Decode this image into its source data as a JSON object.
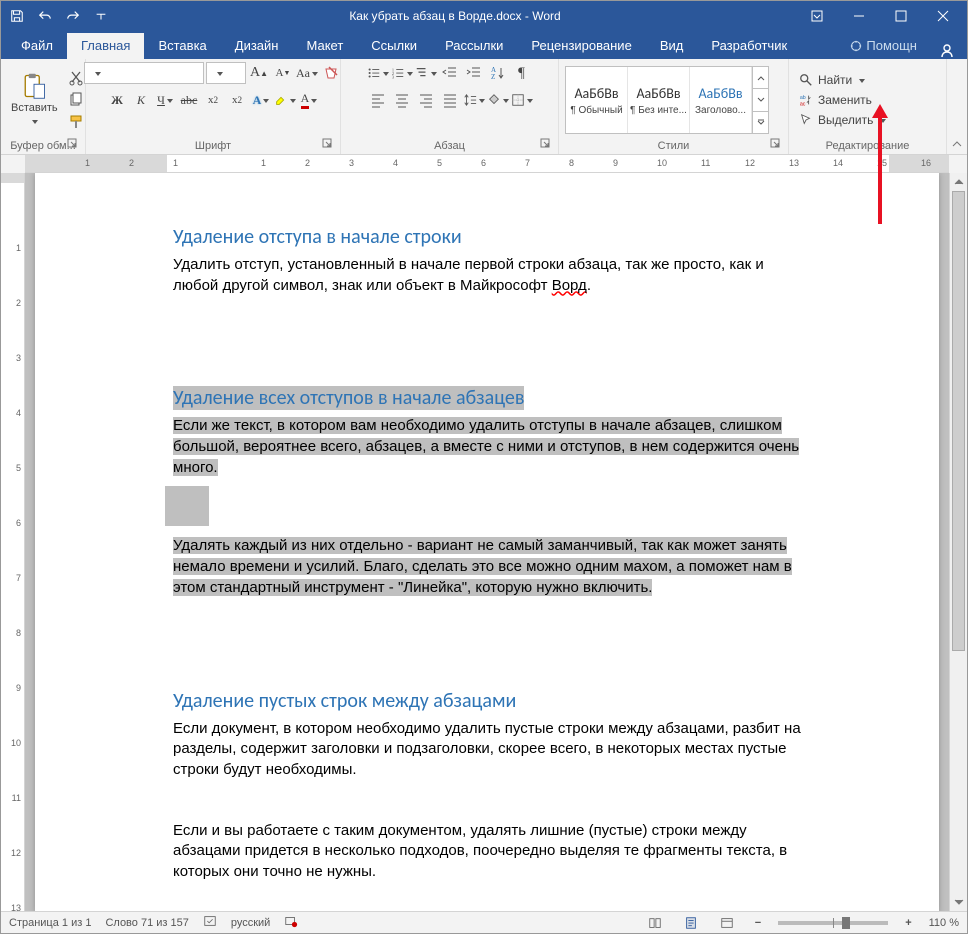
{
  "title_bar": {
    "doc_title": "Как убрать абзац в Ворде.docx - Word"
  },
  "tabs": {
    "file": "Файл",
    "home": "Главная",
    "insert": "Вставка",
    "design": "Дизайн",
    "layout": "Макет",
    "references": "Ссылки",
    "mailings": "Рассылки",
    "review": "Рецензирование",
    "view": "Вид",
    "developer": "Разработчик",
    "help": "Помощн"
  },
  "ribbon": {
    "clipboard": {
      "paste": "Вставить",
      "label": "Буфер обм..."
    },
    "font": {
      "name": "",
      "size": "",
      "label": "Шрифт"
    },
    "paragraph": {
      "label": "Абзац"
    },
    "styles": {
      "label": "Стили",
      "preview": "АаБбВв",
      "items": [
        {
          "name": "¶ Обычный"
        },
        {
          "name": "¶ Без инте..."
        },
        {
          "name": "Заголово..."
        }
      ]
    },
    "editing": {
      "label": "Редактирование",
      "find": "Найти",
      "replace": "Заменить",
      "select": "Выделить"
    }
  },
  "ruler": {
    "h_ticks": [
      "1",
      "2",
      "1",
      "",
      "1",
      "2",
      "3",
      "4",
      "5",
      "6",
      "7",
      "8",
      "9",
      "10",
      "11",
      "12",
      "13",
      "14",
      "15",
      "16"
    ],
    "v_ticks": [
      "",
      "1",
      "2",
      "3",
      "4",
      "5",
      "6",
      "7",
      "8",
      "9",
      "10",
      "11",
      "12",
      "13"
    ]
  },
  "document": {
    "h1": "Удаление отступа в начале строки",
    "p1a": "Удалить отступ, установленный в начале первой строки абзаца, так же просто, как и любой другой символ, знак или объект в Майкрософт ",
    "p1b_spell": "Ворд",
    "p1c": ".",
    "h2": "Удаление всех отступов в начале абзацев",
    "p2": "Если же текст, в котором вам необходимо удалить отступы в начале абзацев, слишком большой, вероятнее всего, абзацев, а вместе с ними и отступов, в нем содержится очень много.",
    "p3": "Удалять каждый из них отдельно - вариант не самый заманчивый, так как может занять немало времени и усилий. Благо, сделать это все можно одним махом, а поможет нам в этом стандартный инструмент - \"Линейка\", которую нужно включить.",
    "h3": "Удаление пустых строк между абзацами",
    "p4": "Если документ, в котором необходимо удалить пустые строки между абзацами, разбит на разделы, содержит заголовки и подзаголовки, скорее всего, в некоторых местах пустые строки будут необходимы.",
    "p5": "Если и вы работаете с таким документом, удалять лишние (пустые) строки между абзацами придется в несколько подходов, поочередно выделяя те фрагменты текста, в которых они точно не нужны."
  },
  "status": {
    "page": "Страница 1 из 1",
    "words": "Слово 71 из 157",
    "lang": "русский",
    "zoom": "110 %"
  }
}
